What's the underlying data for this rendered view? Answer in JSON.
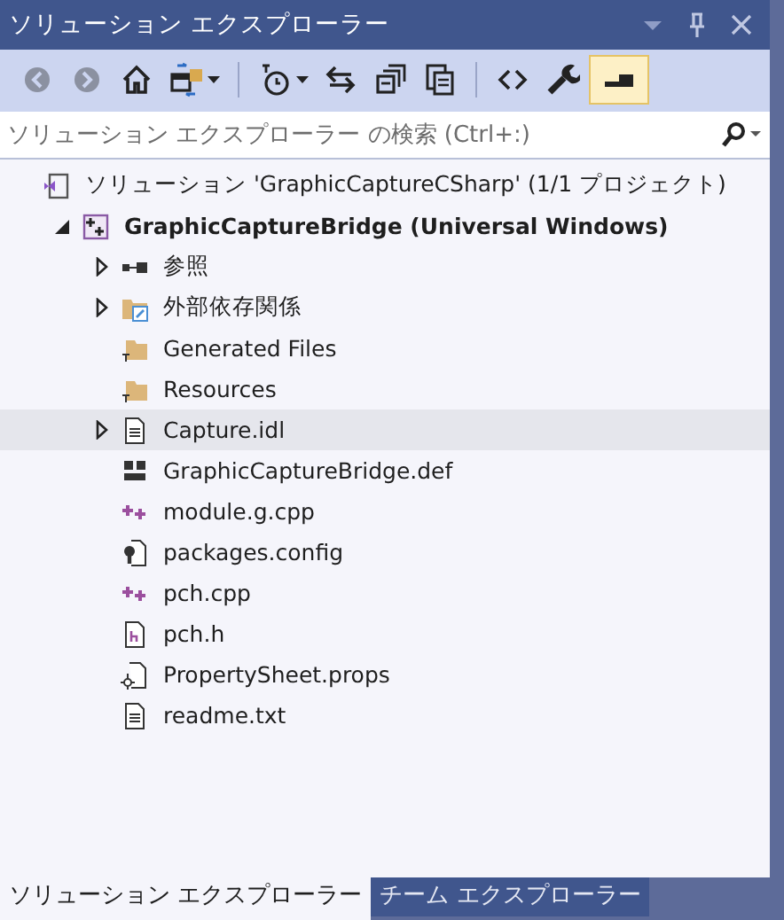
{
  "window": {
    "title": "ソリューション エクスプローラー"
  },
  "toolbar": {
    "groups": [
      [
        {
          "disabled": true,
          "selected": false,
          "dropdown": false
        },
        {
          "disabled": true,
          "selected": false,
          "dropdown": false
        },
        {
          "disabled": false,
          "selected": false,
          "dropdown": false
        },
        {
          "disabled": false,
          "selected": false,
          "dropdown": true
        }
      ],
      [
        {
          "disabled": false,
          "selected": false,
          "dropdown": true
        },
        {
          "disabled": false,
          "selected": false,
          "dropdown": false
        },
        {
          "disabled": false,
          "selected": false,
          "dropdown": false
        },
        {
          "disabled": false,
          "selected": false,
          "dropdown": false
        }
      ],
      [
        {
          "disabled": false,
          "selected": false,
          "dropdown": false
        },
        {
          "disabled": false,
          "selected": false,
          "dropdown": false
        },
        {
          "disabled": false,
          "selected": true,
          "dropdown": false
        }
      ]
    ]
  },
  "search": {
    "placeholder": "ソリューション エクスプローラー の検索 (Ctrl+:)"
  },
  "tree": {
    "items": [
      {
        "kind": "solution",
        "label": "ソリューション 'GraphicCaptureCSharp' (1/1 プロジェクト)",
        "selected": false,
        "children": [
          {
            "kind": "project",
            "label": "GraphicCaptureBridge (Universal Windows)",
            "bold": true,
            "expanded": true,
            "selected": false,
            "children": [
              {
                "kind": "references",
                "label": "参照",
                "expanded": false,
                "selected": false
              },
              {
                "kind": "external",
                "label": "外部依存関係",
                "expanded": false,
                "selected": false
              },
              {
                "kind": "folder",
                "label": "Generated Files",
                "selected": false
              },
              {
                "kind": "folder",
                "label": "Resources",
                "selected": false
              },
              {
                "kind": "text",
                "label": "Capture.idl",
                "expanded": false,
                "selected": true
              },
              {
                "kind": "def",
                "label": "GraphicCaptureBridge.def",
                "selected": false
              },
              {
                "kind": "cpp",
                "label": "module.g.cpp",
                "selected": false
              },
              {
                "kind": "config",
                "label": "packages.config",
                "selected": false
              },
              {
                "kind": "cpp",
                "label": "pch.cpp",
                "selected": false
              },
              {
                "kind": "header",
                "label": "pch.h",
                "selected": false
              },
              {
                "kind": "props",
                "label": "PropertySheet.props",
                "selected": false
              },
              {
                "kind": "text",
                "label": "readme.txt",
                "selected": false
              }
            ]
          }
        ]
      }
    ]
  },
  "bottom_tabs": [
    {
      "label": "ソリューション エクスプローラー",
      "selected": true
    },
    {
      "label": "チーム エクスプローラー",
      "selected": false
    }
  ]
}
